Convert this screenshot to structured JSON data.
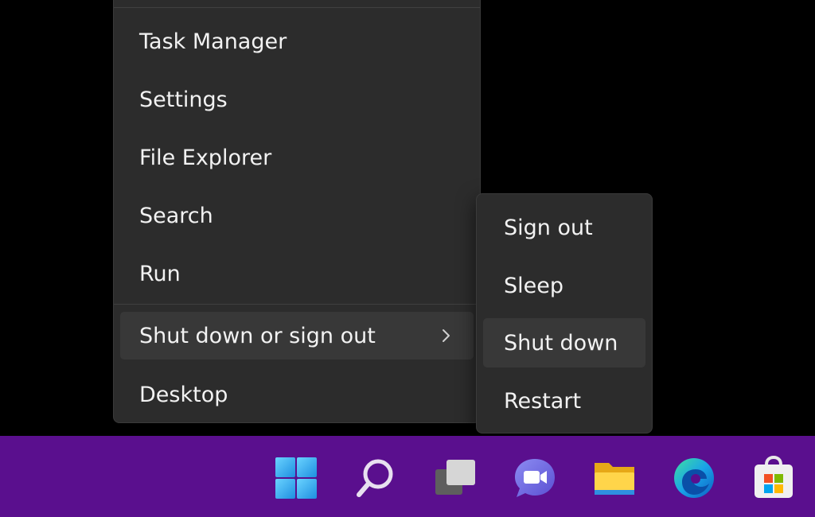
{
  "menu": {
    "items": [
      {
        "label": "Task Manager"
      },
      {
        "label": "Settings"
      },
      {
        "label": "File Explorer"
      },
      {
        "label": "Search"
      },
      {
        "label": "Run"
      },
      {
        "label": "Shut down or sign out"
      },
      {
        "label": "Desktop"
      }
    ]
  },
  "submenu": {
    "items": [
      {
        "label": "Sign out"
      },
      {
        "label": "Sleep"
      },
      {
        "label": "Shut down"
      },
      {
        "label": "Restart"
      }
    ]
  },
  "taskbar": {
    "icons": [
      "windows-start-icon",
      "search-icon",
      "task-view-icon",
      "chat-icon",
      "file-explorer-icon",
      "edge-icon",
      "store-icon"
    ]
  },
  "colors": {
    "taskbar": "#5a0f8e",
    "menu_bg": "#2c2c2c",
    "hover_bg": "#383838",
    "text": "#f2f2f2"
  }
}
